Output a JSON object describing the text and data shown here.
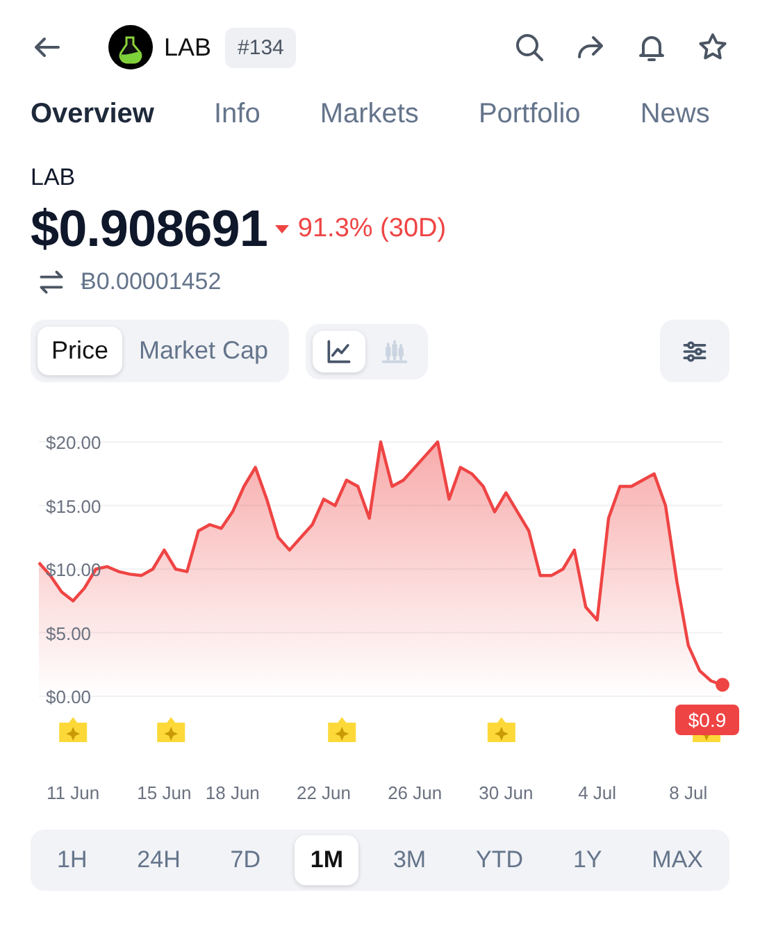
{
  "header": {
    "symbol": "LAB",
    "rank": "#134"
  },
  "tabs": [
    {
      "label": "Overview",
      "selected": true
    },
    {
      "label": "Info",
      "selected": false
    },
    {
      "label": "Markets",
      "selected": false
    },
    {
      "label": "Portfolio",
      "selected": false
    },
    {
      "label": "News",
      "selected": false
    }
  ],
  "coin": {
    "name": "LAB",
    "price": "$0.908691",
    "change": "91.3% (30D)",
    "falling": true,
    "btc_price": "Ƀ0.00001452"
  },
  "metric_toggle": [
    {
      "label": "Price",
      "selected": true
    },
    {
      "label": "Market Cap",
      "selected": false
    }
  ],
  "chart_style": [
    {
      "kind": "line",
      "selected": true
    },
    {
      "kind": "candle",
      "selected": false
    }
  ],
  "chart": {
    "price_tag": "$0.9",
    "chart_data": {
      "type": "area",
      "grid": true,
      "ylim": [
        0,
        20
      ],
      "yticks": [
        {
          "value": 0,
          "label": "$0.00"
        },
        {
          "value": 5,
          "label": "$5.00"
        },
        {
          "value": 10,
          "label": "$10.00"
        },
        {
          "value": 15,
          "label": "$15.00"
        },
        {
          "value": 20,
          "label": "$20.00"
        }
      ],
      "categories": [
        null,
        null,
        null,
        "11 Jun",
        null,
        null,
        null,
        null,
        null,
        null,
        null,
        "15 Jun",
        null,
        null,
        null,
        null,
        null,
        "18 Jun",
        null,
        null,
        null,
        null,
        null,
        null,
        null,
        "22 Jun",
        null,
        null,
        null,
        null,
        null,
        null,
        null,
        "26 Jun",
        null,
        null,
        null,
        null,
        null,
        null,
        null,
        "30 Jun",
        null,
        null,
        null,
        null,
        null,
        null,
        null,
        "4 Jul",
        null,
        null,
        null,
        null,
        null,
        null,
        null,
        "8 Jul",
        null,
        null,
        null
      ],
      "series": [
        {
          "color": "#ef4444",
          "values": [
            10.5,
            9.5,
            8.2,
            7.5,
            8.5,
            10,
            10.2,
            9.8,
            9.6,
            9.5,
            10,
            11.5,
            10,
            9.8,
            13,
            13.5,
            13.2,
            14.5,
            16.5,
            18,
            15.5,
            12.5,
            11.5,
            12.5,
            13.5,
            15.5,
            15,
            17,
            16.5,
            14,
            20,
            16.5,
            17,
            18,
            19,
            20,
            15.5,
            18,
            17.5,
            16.5,
            14.5,
            16,
            14.5,
            13,
            9.5,
            9.5,
            10,
            11.5,
            7,
            6,
            14,
            16.5,
            16.5,
            17,
            17.5,
            15,
            9,
            4,
            2,
            1.2,
            0.9
          ]
        }
      ]
    }
  },
  "timeframes": [
    {
      "label": "1H",
      "selected": false
    },
    {
      "label": "24H",
      "selected": false
    },
    {
      "label": "7D",
      "selected": false
    },
    {
      "label": "1M",
      "selected": true
    },
    {
      "label": "3M",
      "selected": false
    },
    {
      "label": "YTD",
      "selected": false
    },
    {
      "label": "1Y",
      "selected": false
    },
    {
      "label": "MAX",
      "selected": false
    }
  ]
}
